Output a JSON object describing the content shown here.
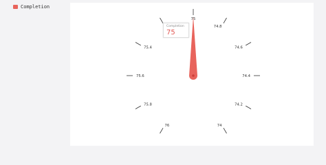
{
  "colors": {
    "series": "#e8645c",
    "series_dark": "#cc3f3a",
    "tick": "#333333"
  },
  "legend": {
    "label": "Completion",
    "icon": "legend-swatch"
  },
  "tooltip": {
    "series_name": "Completion",
    "value": "75"
  },
  "chart_data": {
    "type": "gauge",
    "series": [
      {
        "name": "Completion",
        "value": 75
      }
    ],
    "dial": {
      "labels": [
        "75",
        "74.8",
        "74.6",
        "74.4",
        "74.2",
        "74",
        "76",
        "75.8",
        "75.6",
        "75.4",
        "75.2"
      ],
      "label_angles_deg": [
        0,
        30,
        60,
        90,
        120,
        150,
        210,
        240,
        270,
        300,
        330
      ]
    },
    "pointer_value": 75
  }
}
